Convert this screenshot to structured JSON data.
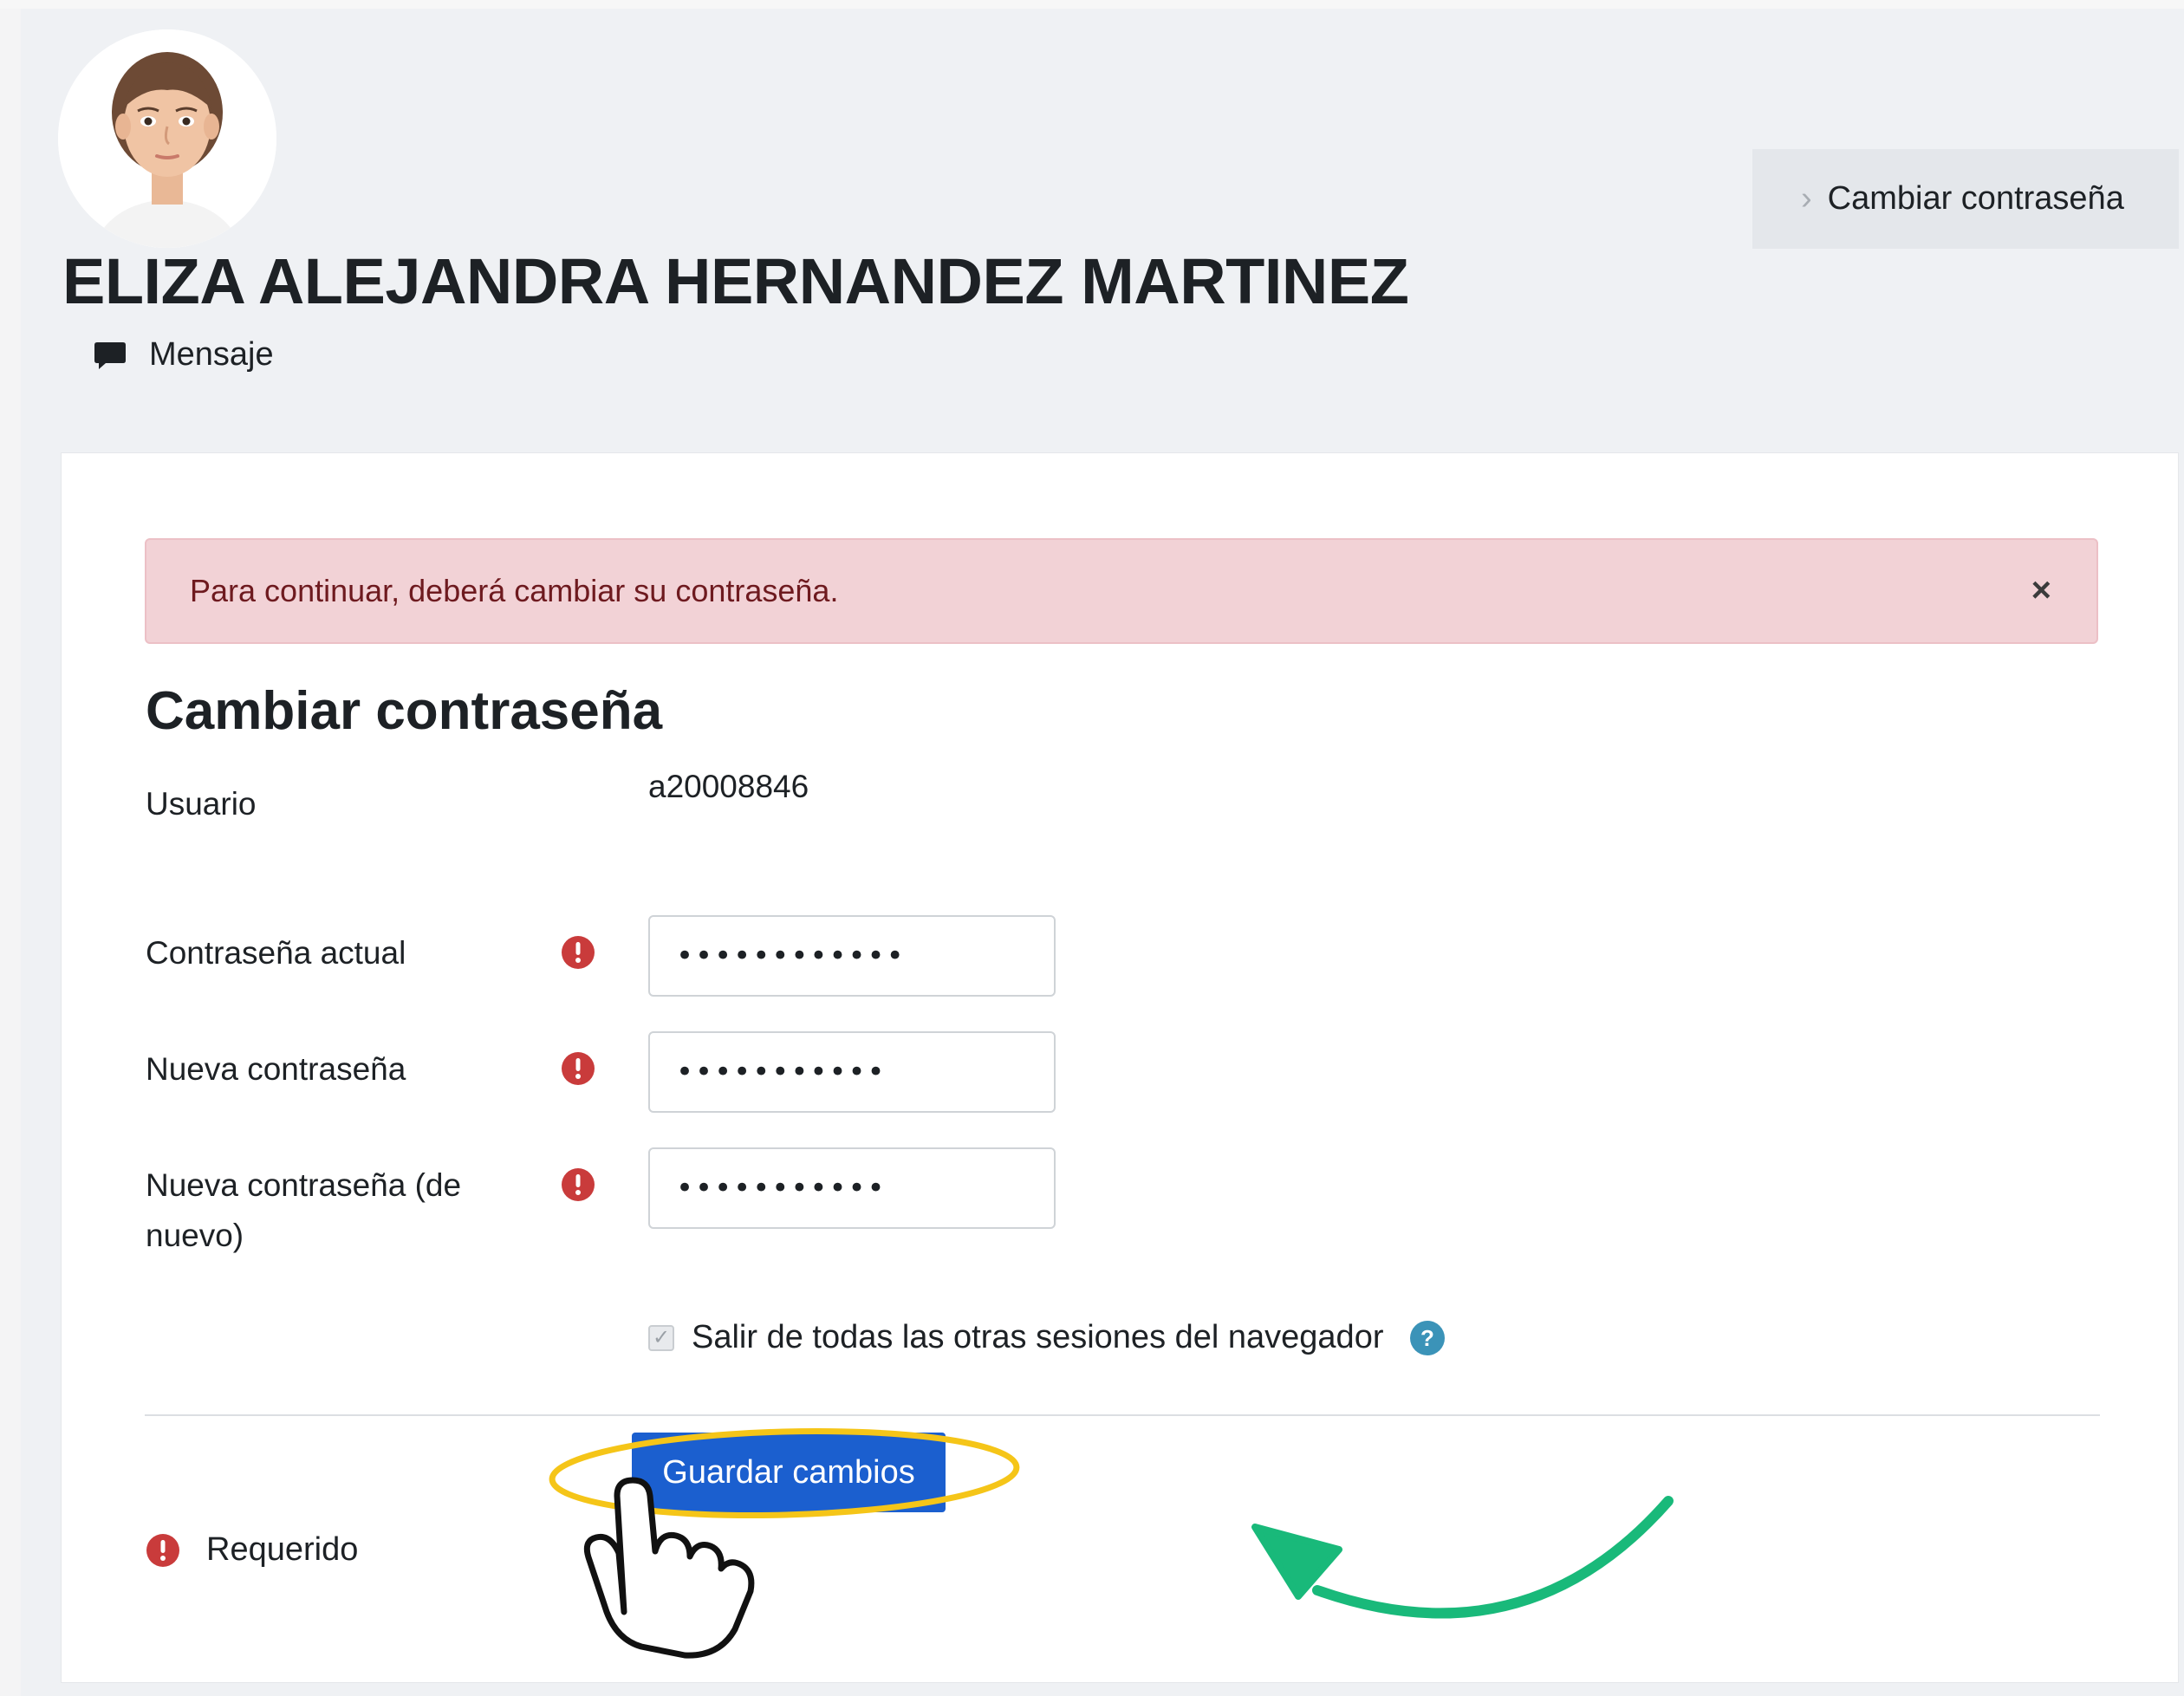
{
  "profile": {
    "full_name": "ELIZA ALEJANDRA HERNANDEZ MARTINEZ",
    "message_label": "Mensaje"
  },
  "breadcrumb": {
    "items": [
      {
        "label": "Cambiar contraseña"
      }
    ]
  },
  "alert": {
    "text": "Para continuar, deberá cambiar su contraseña.",
    "close_label": "×"
  },
  "form": {
    "title": "Cambiar contraseña",
    "username_label": "Usuario",
    "username_value": "a20008846",
    "current_password_label": "Contraseña actual",
    "current_password_value": "••••••••••••",
    "new_password_label": "Nueva contraseña",
    "new_password_value": "•••••••••••",
    "new_password_again_label": "Nueva contraseña (de nuevo)",
    "new_password_again_value": "•••••••••••",
    "logout_sessions_label": "Salir de todas las otras sesiones del navegador",
    "logout_sessions_checked": true,
    "save_button_label": "Guardar cambios",
    "required_legend_label": "Requerido"
  },
  "colors": {
    "required_icon": "#c93b3b",
    "help_icon": "#3b93b8",
    "primary_button": "#1b5fcf",
    "alert_background": "#f2d2d6",
    "highlight_ellipse": "#f5c518",
    "annotation_arrow": "#19b97a"
  },
  "icons": {
    "message": "chat-bubble-icon",
    "required": "exclamation-circle-icon",
    "help": "question-circle-icon",
    "pointer": "hand-pointer-icon",
    "annotation": "curved-arrow-icon"
  }
}
